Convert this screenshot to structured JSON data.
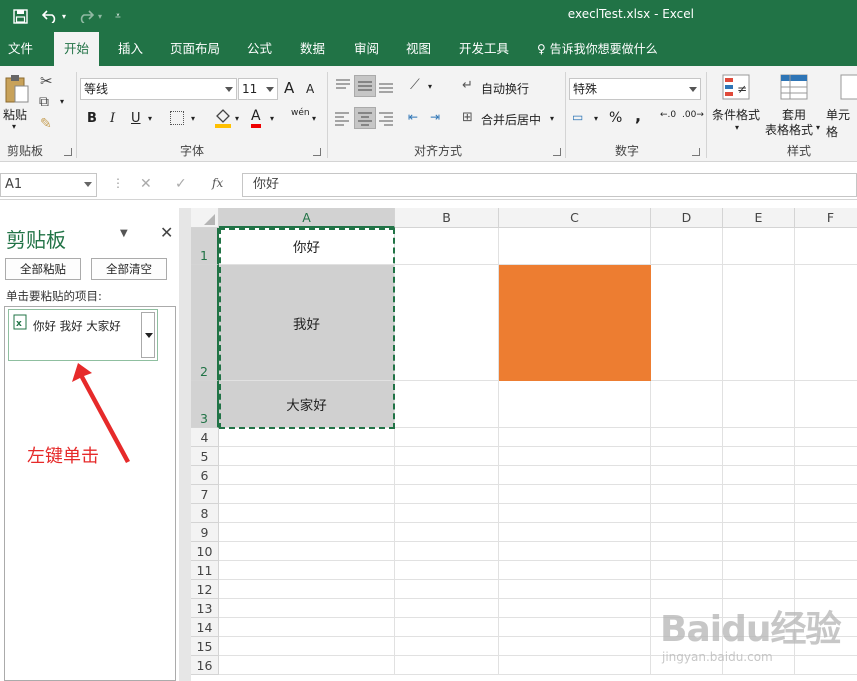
{
  "title_bar": {
    "title": "execlTest.xlsx  -  Excel",
    "bg_color": "#217346"
  },
  "menu_tabs": [
    {
      "label": "文件"
    },
    {
      "label": "开始"
    },
    {
      "label": "插入"
    },
    {
      "label": "页面布局"
    },
    {
      "label": "公式"
    },
    {
      "label": "数据"
    },
    {
      "label": "审阅"
    },
    {
      "label": "视图"
    },
    {
      "label": "开发工具"
    }
  ],
  "tell_me": "告诉我你想要做什么",
  "ribbon": {
    "clipboard": {
      "label": "剪贴板",
      "paste": "粘贴"
    },
    "font": {
      "label": "字体",
      "name": "等线",
      "size": "11",
      "bold": "B",
      "italic": "I",
      "underline": "U",
      "inc": "A",
      "dec": "A",
      "font_color": "A",
      "phonetic": "wén"
    },
    "alignment": {
      "label": "对齐方式",
      "wrap": "自动换行",
      "merge": "合并后居中"
    },
    "number": {
      "label": "数字",
      "format": "特殊",
      "percent": "%",
      "comma": ","
    },
    "styles": {
      "label": "样式",
      "conditional": "条件格式",
      "table1": "套用",
      "table2": "表格格式",
      "cell": "单元格"
    }
  },
  "formula_bar": {
    "name_box": "A1",
    "cancel": "✕",
    "enter": "✓",
    "fx": "fx",
    "content": "你好"
  },
  "clipboard_pane": {
    "title": "剪贴板",
    "paste_all": "全部粘贴",
    "clear_all": "全部清空",
    "hint": "单击要粘贴的项目:",
    "item_text": "你好 我好 大家好"
  },
  "annotation": {
    "text": "左键单击",
    "color": "#e62a2a"
  },
  "sheet": {
    "columns": [
      "A",
      "B",
      "C",
      "D",
      "E",
      "F"
    ],
    "rows": [
      "1",
      "2",
      "3",
      "4",
      "5",
      "6",
      "7",
      "8",
      "9",
      "10",
      "11",
      "12",
      "13",
      "14",
      "15",
      "16"
    ],
    "cells": {
      "A1": "你好",
      "A2": "我好",
      "A3": "大家好"
    },
    "selected_fill": "#d0d0d0",
    "orange_fill": "#ed7d31",
    "selection_color": "#217346"
  },
  "watermark": {
    "logo": "Baidu经验",
    "sub": "jingyan.baidu.com"
  }
}
